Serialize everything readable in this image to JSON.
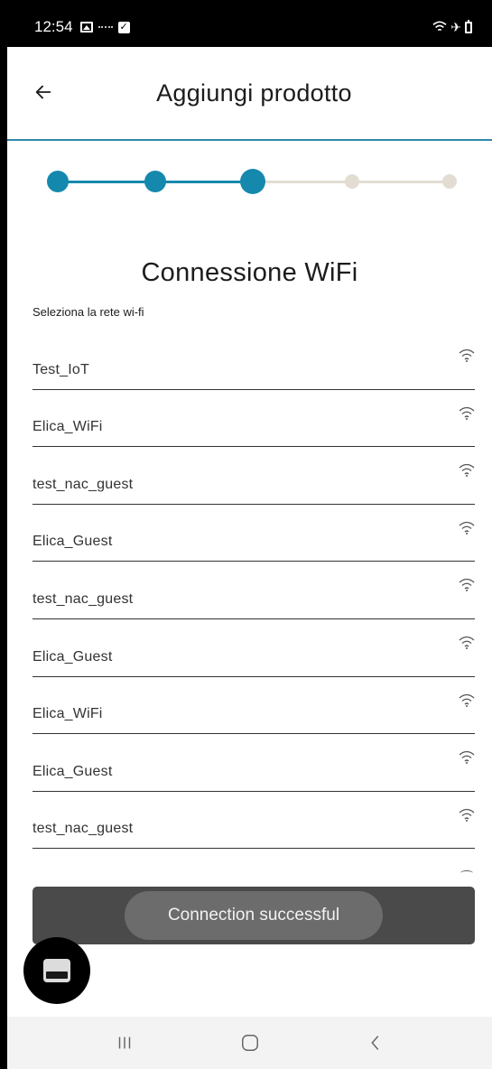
{
  "status_bar": {
    "time": "12:54",
    "left_icons": [
      "image-icon",
      "notification-dots-icon",
      "checkbox-icon"
    ],
    "right_icons": [
      "wifi-icon",
      "airplane-icon",
      "battery-icon"
    ]
  },
  "app_bar": {
    "back_icon": "arrow-left-icon",
    "title": "Aggiungi prodotto"
  },
  "stepper": {
    "total_steps": 5,
    "current_step": 3,
    "active_color": "#1589ad",
    "inactive_color": "#e2dcd2"
  },
  "section": {
    "title": "Connessione WiFi",
    "subtitle": "Seleziona la rete wi-fi"
  },
  "networks": [
    {
      "name": "Test_IoT",
      "icon": "wifi-icon"
    },
    {
      "name": "Elica_WiFi",
      "icon": "wifi-icon"
    },
    {
      "name": "test_nac_guest",
      "icon": "wifi-icon"
    },
    {
      "name": "Elica_Guest",
      "icon": "wifi-icon"
    },
    {
      "name": "test_nac_guest",
      "icon": "wifi-icon"
    },
    {
      "name": "Elica_Guest",
      "icon": "wifi-icon"
    },
    {
      "name": "Elica_WiFi",
      "icon": "wifi-icon"
    },
    {
      "name": "Elica_Guest",
      "icon": "wifi-icon"
    },
    {
      "name": "test_nac_guest",
      "icon": "wifi-icon"
    }
  ],
  "toast": {
    "message": "Connection successful"
  },
  "fab": {
    "icon": "appliance-icon"
  },
  "nav_bar": {
    "icons": [
      "recent-apps-icon",
      "home-icon",
      "back-icon"
    ]
  }
}
